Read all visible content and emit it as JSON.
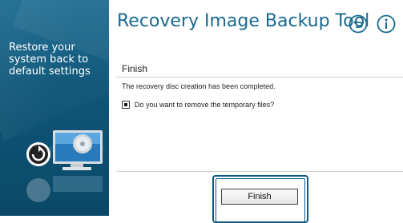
{
  "sidebar": {
    "tagline": "Restore your system back to default settings",
    "illustration_icon": "monitor-restore-disc-icon"
  },
  "header": {
    "title": "Recovery Image Backup Tool",
    "back_icon": "back-arrow-circle-icon",
    "info_icon": "info-circle-icon",
    "accent_color": "#17698f"
  },
  "main": {
    "section_title": "Finish",
    "message": "The recovery disc creation has been completed.",
    "checkbox": {
      "label": "Do you want to remove the temporary files?",
      "checked": true
    },
    "finish_button_label": "Finish"
  }
}
